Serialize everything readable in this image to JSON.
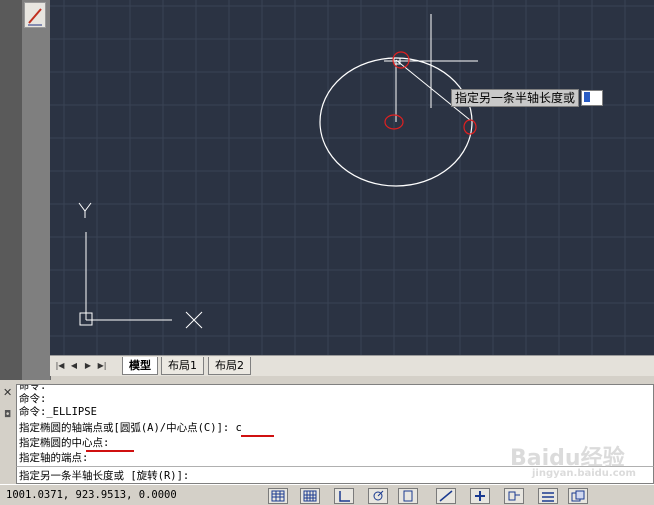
{
  "colors": {
    "canvas_bg": "#2b3343",
    "grid": "#3a4354",
    "geometry": "#ffffff",
    "highlight": "#e02020",
    "underline": "#d01010"
  },
  "tabs": [
    {
      "label": "模型",
      "active": true
    },
    {
      "label": "布局1",
      "active": false
    },
    {
      "label": "布局2",
      "active": false
    }
  ],
  "canvas": {
    "ucs_y_label": "Y",
    "ucs_x_label": "X",
    "dynamic_prompt": "指定另一条半轴长度或"
  },
  "command_history": [
    "命令:",
    "命令:",
    "命令:_ELLIPSE",
    "指定椭圆的轴端点或[圆弧(A)/中心点(C)]: c",
    "指定椭圆的中心点:",
    "指定轴的端点:"
  ],
  "command_prompt": "指定另一条半轴长度或 [旋转(R)]:",
  "status": {
    "coordinates": "1001.0371, 923.9513, 0.0000"
  },
  "icons": [
    "close-icon",
    "pin-icon",
    "snap-icon",
    "grid-icon",
    "ortho-icon",
    "polar-icon",
    "osnap-icon",
    "otrack-icon",
    "ducs-icon",
    "dyn-icon",
    "lineweight-icon",
    "model-icon"
  ],
  "watermark": {
    "brand": "Baidu经验",
    "sub": "jingyan.baidu.com"
  }
}
